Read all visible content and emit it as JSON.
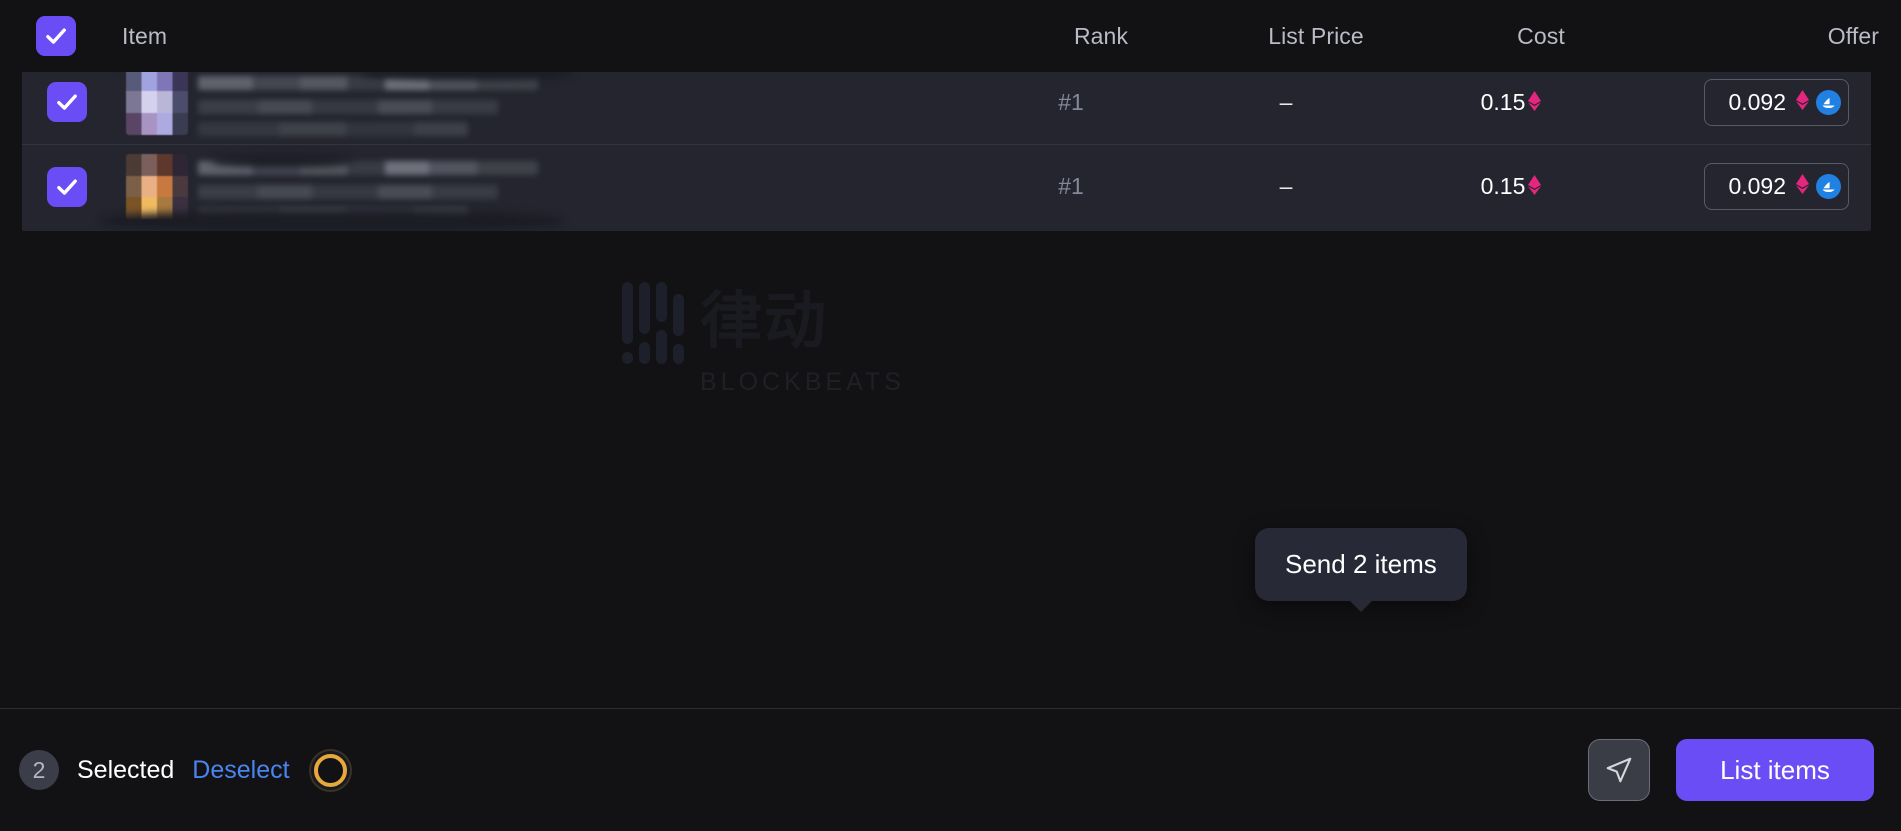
{
  "table": {
    "headers": {
      "item": "Item",
      "rank": "Rank",
      "list_price": "List Price",
      "cost": "Cost",
      "offer": "Offer"
    },
    "header_checkbox_checked": true,
    "rows": [
      {
        "checked": true,
        "item_name": "",
        "rank": "#1",
        "list_price": "–",
        "cost": "0.15",
        "cost_currency_icon": "ethereum-icon",
        "offer_value": "0.092",
        "offer_currency_icon": "ethereum-icon",
        "marketplace_icon": "opensea-icon"
      },
      {
        "checked": true,
        "item_name": "",
        "rank": "#1",
        "list_price": "–",
        "cost": "0.15",
        "cost_currency_icon": "ethereum-icon",
        "offer_value": "0.092",
        "offer_currency_icon": "ethereum-icon",
        "marketplace_icon": "opensea-icon"
      }
    ]
  },
  "watermark": {
    "cn_text": "律动",
    "name": "BLOCKBEATS"
  },
  "tooltip": {
    "text": "Send 2 items"
  },
  "bottom_bar": {
    "selected_count": "2",
    "selected_label": "Selected",
    "deselect_label": "Deselect",
    "ring_icon": "gold-ring-icon",
    "send_button_icon": "send-paper-plane-icon",
    "list_items_label": "List items"
  },
  "colors": {
    "background": "#121214",
    "row_background": "#24252f",
    "accent_purple": "#6b4df6",
    "link_blue": "#4a84f0",
    "ethereum_pink": "#e5267f",
    "opensea_blue": "#2081e2",
    "gold_ring": "#e7a83c"
  }
}
